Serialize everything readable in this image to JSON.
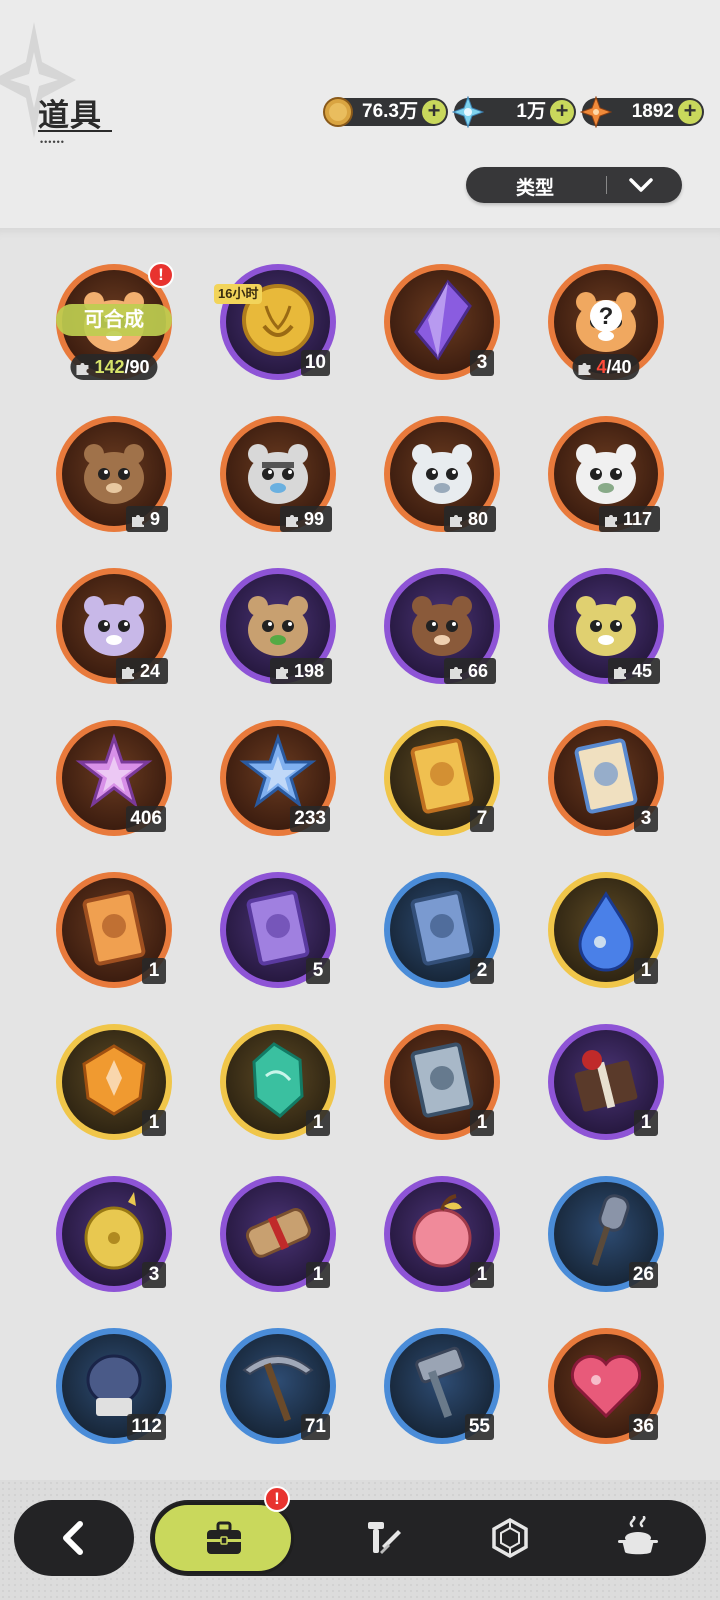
{
  "header": {
    "title": "道具"
  },
  "currencies": [
    {
      "name": "gold-coin",
      "icon": "gold-coin-icon",
      "value": "76.3万",
      "color": "#d9a441"
    },
    {
      "name": "crystal",
      "icon": "snowflake-crystal-icon",
      "value": "1万",
      "color": "#6fc8e8"
    },
    {
      "name": "star-shard",
      "icon": "orange-star-icon",
      "value": "1892",
      "color": "#f08a3a"
    }
  ],
  "filter": {
    "label": "类型"
  },
  "items": [
    {
      "icon": "tiger-cub-icon",
      "ring": "orange",
      "shards": true,
      "owned": "142",
      "need": "/90",
      "craftable": "可合成",
      "alert": "!"
    },
    {
      "icon": "laurel-coin-icon",
      "ring": "purple",
      "qty": "10",
      "timer": "16小时"
    },
    {
      "icon": "purple-crystal-icon",
      "ring": "orange",
      "qty": "3"
    },
    {
      "icon": "mystery-pet-icon",
      "ring": "orange",
      "shards": true,
      "owned": "4",
      "need": "/40"
    },
    {
      "icon": "bear-cub-icon",
      "ring": "orange",
      "shards": true,
      "qty": "9"
    },
    {
      "icon": "knight-pet-icon",
      "ring": "orange",
      "shards": true,
      "qty": "99"
    },
    {
      "icon": "white-tiger-icon",
      "ring": "orange",
      "shards": true,
      "qty": "80"
    },
    {
      "icon": "white-cat-icon",
      "ring": "orange",
      "shards": true,
      "qty": "117"
    },
    {
      "icon": "lilac-cat-icon",
      "ring": "orange",
      "shards": true,
      "qty": "24"
    },
    {
      "icon": "tanuki-icon",
      "ring": "purple",
      "shards": true,
      "qty": "198"
    },
    {
      "icon": "brown-bear-icon",
      "ring": "purple",
      "shards": true,
      "qty": "66"
    },
    {
      "icon": "yellow-cat-icon",
      "ring": "purple",
      "shards": true,
      "qty": "45"
    },
    {
      "icon": "pink-star-crystal-icon",
      "ring": "orange",
      "qty": "406"
    },
    {
      "icon": "blue-star-crystal-icon",
      "ring": "orange",
      "qty": "233"
    },
    {
      "icon": "gold-card-icon",
      "ring": "gold",
      "qty": "7"
    },
    {
      "icon": "gift-card-icon",
      "ring": "orange",
      "qty": "3"
    },
    {
      "icon": "orange-card-icon",
      "ring": "orange",
      "qty": "1"
    },
    {
      "icon": "purple-card-icon",
      "ring": "purple",
      "qty": "5"
    },
    {
      "icon": "blue-card-icon",
      "ring": "blue",
      "qty": "2"
    },
    {
      "icon": "water-drop-icon",
      "ring": "gold",
      "qty": "1"
    },
    {
      "icon": "amber-stone-icon",
      "ring": "gold",
      "qty": "1"
    },
    {
      "icon": "jade-stone-icon",
      "ring": "gold",
      "qty": "1"
    },
    {
      "icon": "rune-card-icon",
      "ring": "orange",
      "qty": "1"
    },
    {
      "icon": "gift-box-icon",
      "ring": "purple",
      "qty": "1"
    },
    {
      "icon": "golden-egg-icon",
      "ring": "purple",
      "qty": "3"
    },
    {
      "icon": "scroll-icon",
      "ring": "purple",
      "qty": "1"
    },
    {
      "icon": "pink-apple-icon",
      "ring": "purple",
      "qty": "1"
    },
    {
      "icon": "shovel-icon",
      "ring": "blue",
      "qty": "26"
    },
    {
      "icon": "boxing-glove-icon",
      "ring": "blue",
      "qty": "112"
    },
    {
      "icon": "pickaxe-icon",
      "ring": "blue",
      "qty": "71"
    },
    {
      "icon": "hammer-icon",
      "ring": "blue",
      "qty": "55"
    },
    {
      "icon": "ruby-heart-icon",
      "ring": "orange",
      "qty": "36"
    }
  ],
  "nav": {
    "tabs": [
      {
        "name": "bag",
        "icon": "bag-icon",
        "active": true,
        "alert": "!"
      },
      {
        "name": "forge",
        "icon": "tools-icon",
        "active": false
      },
      {
        "name": "gem",
        "icon": "gem-icon",
        "active": false
      },
      {
        "name": "cooking",
        "icon": "cooking-pot-icon",
        "active": false
      }
    ]
  },
  "colors": {
    "accent": "#c9d85c",
    "dark": "#232325",
    "alert": "#e8332f"
  }
}
